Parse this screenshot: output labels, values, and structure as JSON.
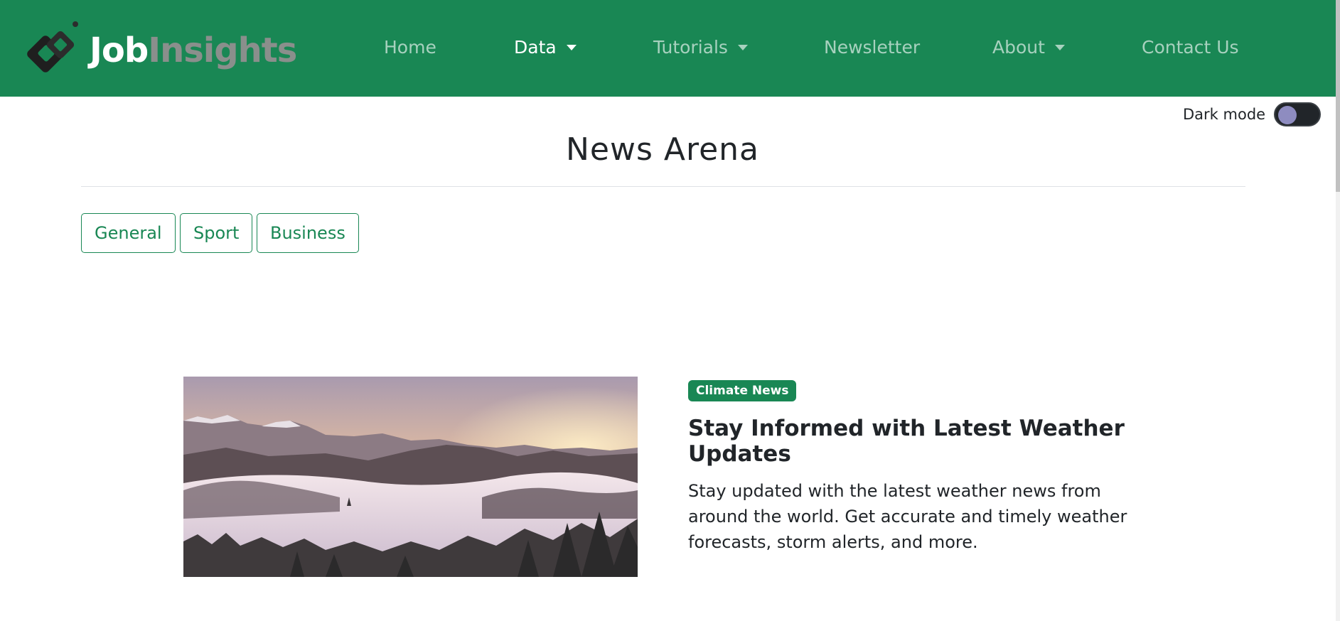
{
  "brand": {
    "name_part1": "Job",
    "name_part2": "Insights",
    "logo_icon": "diamond-logo-icon"
  },
  "nav": {
    "home": "Home",
    "data": "Data",
    "tutorials": "Tutorials",
    "newsletter": "Newsletter",
    "about": "About",
    "contact": "Contact Us"
  },
  "dark_mode": {
    "label": "Dark mode",
    "enabled": false
  },
  "page": {
    "title": "News Arena"
  },
  "categories": [
    "General",
    "Sport",
    "Business"
  ],
  "article": {
    "badge": "Climate News",
    "headline": "Stay Informed with Latest Weather Updates",
    "summary": "Stay updated with the latest weather news from around the world. Get accurate and timely weather forecasts, storm alerts, and more."
  },
  "colors": {
    "primary": "#198754",
    "text": "#212529",
    "toggle_bg": "#212529",
    "toggle_knob": "#8e8cc0"
  }
}
